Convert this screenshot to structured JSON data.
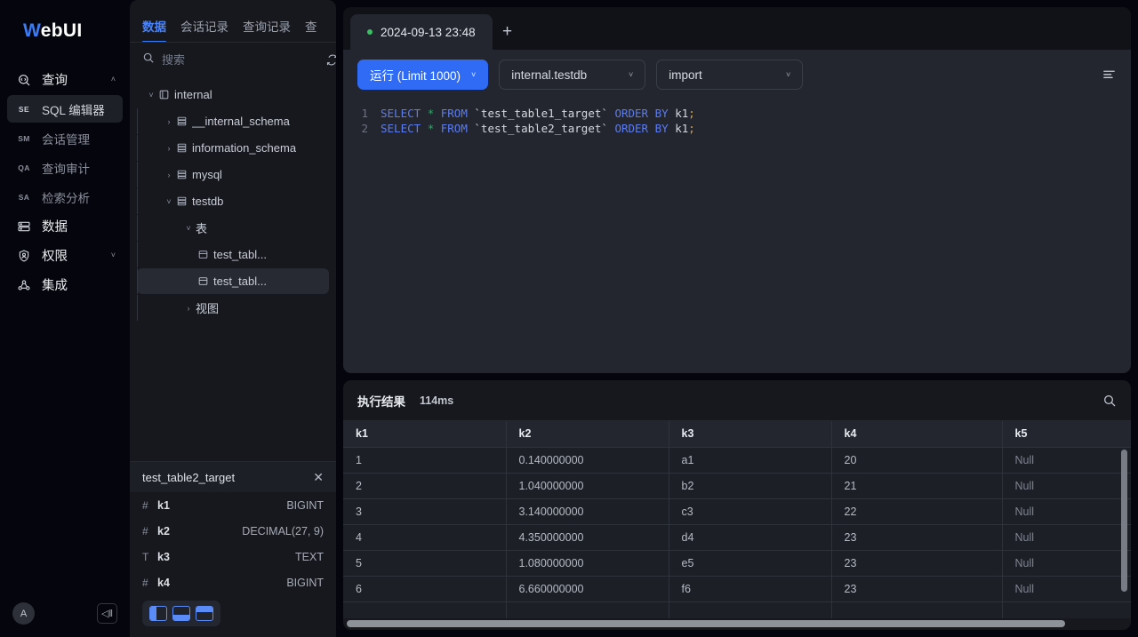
{
  "sidebar": {
    "brand_first": "W",
    "brand_rest": "ebUI",
    "items": [
      {
        "label": "查询",
        "icon": "code-search-icon",
        "abbr": "",
        "chevron": "˄",
        "active": false,
        "group": true
      },
      {
        "label": "SQL 编辑器",
        "icon": "",
        "abbr": "SE",
        "chevron": "",
        "active": true,
        "group": false
      },
      {
        "label": "会话管理",
        "icon": "",
        "abbr": "SM",
        "chevron": "",
        "active": false,
        "group": false
      },
      {
        "label": "查询审计",
        "icon": "",
        "abbr": "QA",
        "chevron": "",
        "active": false,
        "group": false
      },
      {
        "label": "检索分析",
        "icon": "",
        "abbr": "SA",
        "chevron": "",
        "active": false,
        "group": false
      },
      {
        "label": "数据",
        "icon": "database-icon",
        "abbr": "",
        "chevron": "",
        "active": false,
        "group": true
      },
      {
        "label": "权限",
        "icon": "shield-user-icon",
        "abbr": "",
        "chevron": "˅",
        "active": false,
        "group": true
      },
      {
        "label": "集成",
        "icon": "integration-icon",
        "abbr": "",
        "chevron": "",
        "active": false,
        "group": true
      }
    ],
    "avatar_letter": "A",
    "collapse_label": "◁ǁ"
  },
  "tree_panel": {
    "tabs": [
      {
        "label": "数据",
        "active": true
      },
      {
        "label": "会话记录",
        "active": false
      },
      {
        "label": "查询记录",
        "active": false
      },
      {
        "label": "查",
        "active": false
      }
    ],
    "search_placeholder": "搜索",
    "search_value": "",
    "nodes": [
      {
        "label": "internal",
        "depth": 0,
        "arrow": "˅",
        "icon": "catalog-icon",
        "selected": false
      },
      {
        "label": "__internal_schema",
        "depth": 1,
        "arrow": "›",
        "icon": "database-icon",
        "selected": false
      },
      {
        "label": "information_schema",
        "depth": 1,
        "arrow": "›",
        "icon": "database-icon",
        "selected": false
      },
      {
        "label": "mysql",
        "depth": 1,
        "arrow": "›",
        "icon": "database-icon",
        "selected": false
      },
      {
        "label": "testdb",
        "depth": 1,
        "arrow": "˅",
        "icon": "database-icon",
        "selected": false
      },
      {
        "label": "表",
        "depth": 2,
        "arrow": "˅",
        "icon": "",
        "selected": false
      },
      {
        "label": "test_tabl...",
        "depth": 3,
        "arrow": "",
        "icon": "table-icon",
        "selected": false
      },
      {
        "label": "test_tabl...",
        "depth": 3,
        "arrow": "",
        "icon": "table-icon",
        "selected": true
      },
      {
        "label": "视图",
        "depth": 2,
        "arrow": "›",
        "icon": "",
        "selected": false
      }
    ],
    "columns_card": {
      "title": "test_table2_target",
      "close_label": "✕",
      "columns": [
        {
          "name": "k1",
          "type": "BIGINT",
          "kind": "number"
        },
        {
          "name": "k2",
          "type": "DECIMAL(27, 9)",
          "kind": "number"
        },
        {
          "name": "k3",
          "type": "TEXT",
          "kind": "text"
        },
        {
          "name": "k4",
          "type": "BIGINT",
          "kind": "number"
        }
      ],
      "layout_buttons": [
        "split-left-icon",
        "split-bottom-icon",
        "split-top-icon"
      ]
    }
  },
  "editor": {
    "tab": {
      "label": "2024-09-13 23:48",
      "status": "running"
    },
    "add_tab_label": "+",
    "run_button": {
      "label": "运行 (Limit 1000)",
      "chevron": "˅"
    },
    "catalog_select": {
      "value": "internal.testdb",
      "chevron": "˅"
    },
    "mode_select": {
      "value": "import",
      "chevron": "˅"
    },
    "format_icon": "format-align-icon",
    "lines": [
      {
        "no": "1",
        "kw1": "SELECT",
        "star": "*",
        "kw2": "FROM",
        "ident": "`test_table1_target`",
        "kw3": "ORDER BY",
        "col": "k1",
        "semi": ";"
      },
      {
        "no": "2",
        "kw1": "SELECT",
        "star": "*",
        "kw2": "FROM",
        "ident": "`test_table2_target`",
        "kw3": "ORDER BY",
        "col": "k1",
        "semi": ";"
      }
    ]
  },
  "results": {
    "title": "执行结果",
    "elapsed": "114ms",
    "search_icon": "search-icon",
    "headers": [
      "k1",
      "k2",
      "k3",
      "k4",
      "k5"
    ],
    "rows": [
      [
        "1",
        "0.140000000",
        "a1",
        "20",
        "Null"
      ],
      [
        "2",
        "1.040000000",
        "b2",
        "21",
        "Null"
      ],
      [
        "3",
        "3.140000000",
        "c3",
        "22",
        "Null"
      ],
      [
        "4",
        "4.350000000",
        "d4",
        "23",
        "Null"
      ],
      [
        "5",
        "1.080000000",
        "e5",
        "23",
        "Null"
      ],
      [
        "6",
        "6.660000000",
        "f6",
        "23",
        "Null"
      ]
    ]
  },
  "colors": {
    "accent": "#2f6bf5",
    "tab_active": "#4b84f7",
    "status_dot": "#3bbf64",
    "page_bg": "#05060d",
    "panel_bg": "#16181e"
  }
}
